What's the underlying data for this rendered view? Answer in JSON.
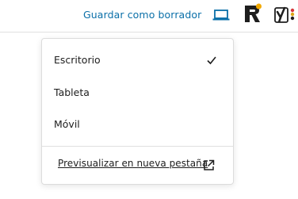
{
  "header": {
    "save_draft_label": "Guardar como borrador",
    "preview_icon": "laptop-icon",
    "rankmath_icon": "rank-math-logo-icon",
    "yoast_icon": "yoast-logo-icon",
    "accent_color": "#0a6fa8"
  },
  "preview_menu": {
    "options": [
      {
        "label": "Escritorio",
        "selected": true
      },
      {
        "label": "Tableta",
        "selected": false
      },
      {
        "label": "Móvil",
        "selected": false
      }
    ],
    "selected_icon": "checkmark-icon",
    "preview_link_label": "Previsualizar en nueva pestaña",
    "preview_link_icon": "external-link-icon"
  }
}
